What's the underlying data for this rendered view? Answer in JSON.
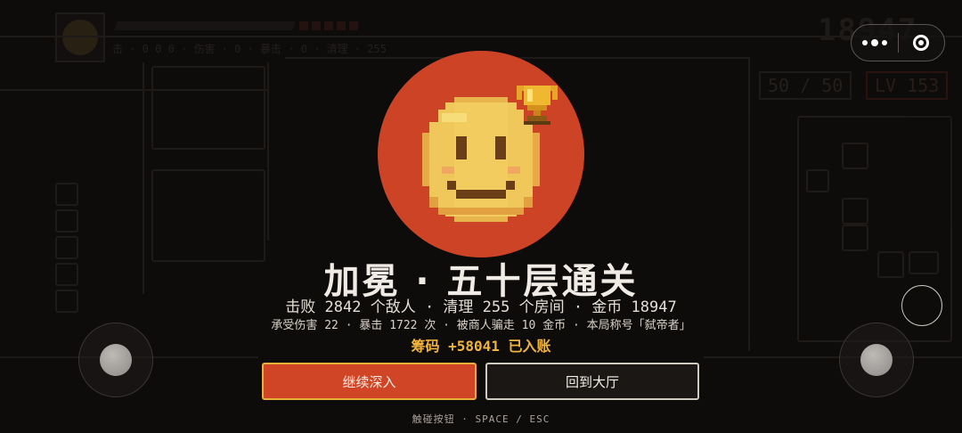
{
  "hud": {
    "top_left_text": "击 · 0 0 0 · 伤害 · 0 · 暴击 · 0 · 清理 · 255",
    "gold_bg": "18947",
    "hp_display": "50 / 50",
    "level_display": "LV 153"
  },
  "capsule": {
    "more_icon": "more-dots-icon",
    "close_icon": "close-target-icon"
  },
  "result": {
    "title": "加冕 · 五十层通关",
    "summary": "击败 2842 个敌人 · 清理 255 个房间 · 金币 18947",
    "details": "承受伤害 22 · 暴击 1722 次 · 被商人骗走 10 金币 · 本局称号「弑帝者」",
    "chips": "筹码 +58041 已入账"
  },
  "buttons": {
    "continue": "继续深入",
    "lobby": "回到大厅"
  },
  "hint": "触碰按钮 · SPACE / ESC",
  "colors": {
    "accent": "#cd4326",
    "gold": "#f0b33c",
    "background": "#0e0c0b"
  },
  "icons": {
    "emblem": "smiley-face-icon",
    "trophy": "trophy-icon"
  }
}
